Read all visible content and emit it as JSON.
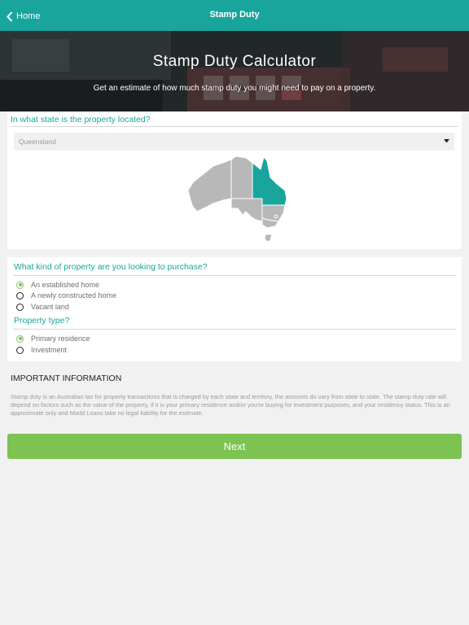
{
  "navbar": {
    "back_label": "Home",
    "title": "Stamp Duty",
    "color": "#1aa59c"
  },
  "hero": {
    "title": "Stamp Duty Calculator",
    "subtitle": "Get an estimate of how much stamp duty you might need to pay on a property."
  },
  "state_section": {
    "question": "In what state is the property located?",
    "selected_state": "Queensland",
    "map_highlight_color": "#1aa59c"
  },
  "property_section": {
    "question": "What kind of property are you looking to purchase?",
    "options": [
      {
        "label": "An established home",
        "selected": true
      },
      {
        "label": "A newly constructed home",
        "selected": false
      },
      {
        "label": "Vacant land",
        "selected": false
      }
    ],
    "type_question": "Property type?",
    "type_options": [
      {
        "label": "Primary residence",
        "selected": true
      },
      {
        "label": "Investment",
        "selected": false
      }
    ]
  },
  "info": {
    "title": "IMPORTANT INFORMATION",
    "body": "Stamp duty is an Australian tax for property transactions that is charged by each state and territory, the amounts do vary from state to state. The stamp duty rate will depend on factors such as the value of the property, if it is your primary residence and/or you're buying for investment purposes, and your residency status.  This is an approximate only and Madd Loans take no legal liability for the estimate."
  },
  "next_button": {
    "label": "Next",
    "color": "#7cc352"
  }
}
